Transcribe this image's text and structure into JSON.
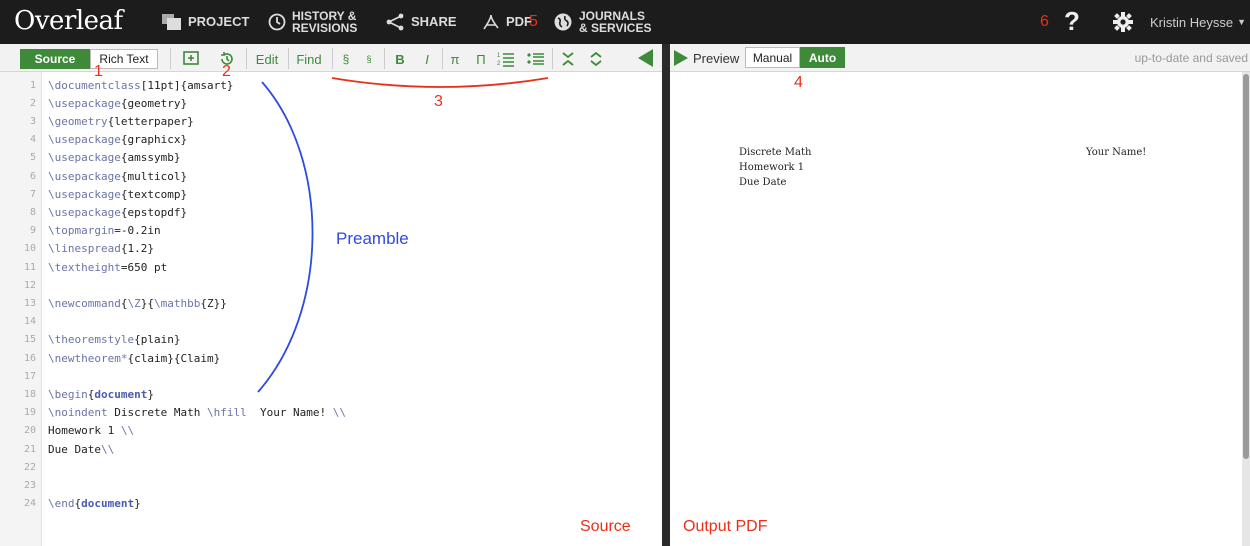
{
  "app": {
    "logo": "Overleaf"
  },
  "topnav": {
    "project": "PROJECT",
    "history_line1": "HISTORY &",
    "history_line2": "REVISIONS",
    "share": "SHARE",
    "pdf": "PDF",
    "journals_line1": "JOURNALS",
    "journals_line2": "& SERVICES",
    "help_icon": "?",
    "user_name": "Kristin Heysse"
  },
  "editor_toolbar": {
    "source": "Source",
    "rich_text": "Rich Text",
    "edit": "Edit",
    "find": "Find",
    "section": "§",
    "subsection": "§",
    "bold": "B",
    "italic": "I",
    "pi": "π",
    "big_pi": "Π"
  },
  "preview_toolbar": {
    "preview": "Preview",
    "manual": "Manual",
    "auto": "Auto",
    "status": "up-to-date and saved"
  },
  "code_lines": [
    {
      "n": "1",
      "text": "\\documentclass[11pt]{amsart}"
    },
    {
      "n": "2",
      "text": "\\usepackage{geometry}"
    },
    {
      "n": "3",
      "text": "\\geometry{letterpaper}"
    },
    {
      "n": "4",
      "text": "\\usepackage{graphicx}"
    },
    {
      "n": "5",
      "text": "\\usepackage{amssymb}"
    },
    {
      "n": "6",
      "text": "\\usepackage{multicol}"
    },
    {
      "n": "7",
      "text": "\\usepackage{textcomp}"
    },
    {
      "n": "8",
      "text": "\\usepackage{epstopdf}"
    },
    {
      "n": "9",
      "text": "\\topmargin=-0.2in"
    },
    {
      "n": "10",
      "text": "\\linespread{1.2}"
    },
    {
      "n": "11",
      "text": "\\textheight=650 pt"
    },
    {
      "n": "12",
      "text": ""
    },
    {
      "n": "13",
      "text": "\\newcommand{\\Z}{\\mathbb{Z}}"
    },
    {
      "n": "14",
      "text": ""
    },
    {
      "n": "15",
      "text": "\\theoremstyle{plain}"
    },
    {
      "n": "16",
      "text": "\\newtheorem*{claim}{Claim}"
    },
    {
      "n": "17",
      "text": ""
    },
    {
      "n": "18",
      "text": "\\begin{document}"
    },
    {
      "n": "19",
      "text": "\\noindent Discrete Math \\hfill  Your Name! \\\\"
    },
    {
      "n": "20",
      "text": "Homework 1 \\\\"
    },
    {
      "n": "21",
      "text": "Due Date\\\\"
    },
    {
      "n": "22",
      "text": ""
    },
    {
      "n": "23",
      "text": ""
    },
    {
      "n": "24",
      "text": "\\end{document}"
    }
  ],
  "pdf": {
    "line1_left": "Discrete Math",
    "line1_right": "Your Name!",
    "line2": "Homework 1",
    "line3": "Due Date"
  },
  "annotations": {
    "n1": "1",
    "n2": "2",
    "n3": "3",
    "n4": "4",
    "n5": "5",
    "n6": "6",
    "preamble": "Preamble",
    "source": "Source",
    "output_pdf": "Output PDF",
    "red_color": "#e8301b",
    "blue_color": "#2f4be0"
  },
  "colors": {
    "accent_green": "#3e8a3a",
    "topbar": "#1c1c1c"
  }
}
